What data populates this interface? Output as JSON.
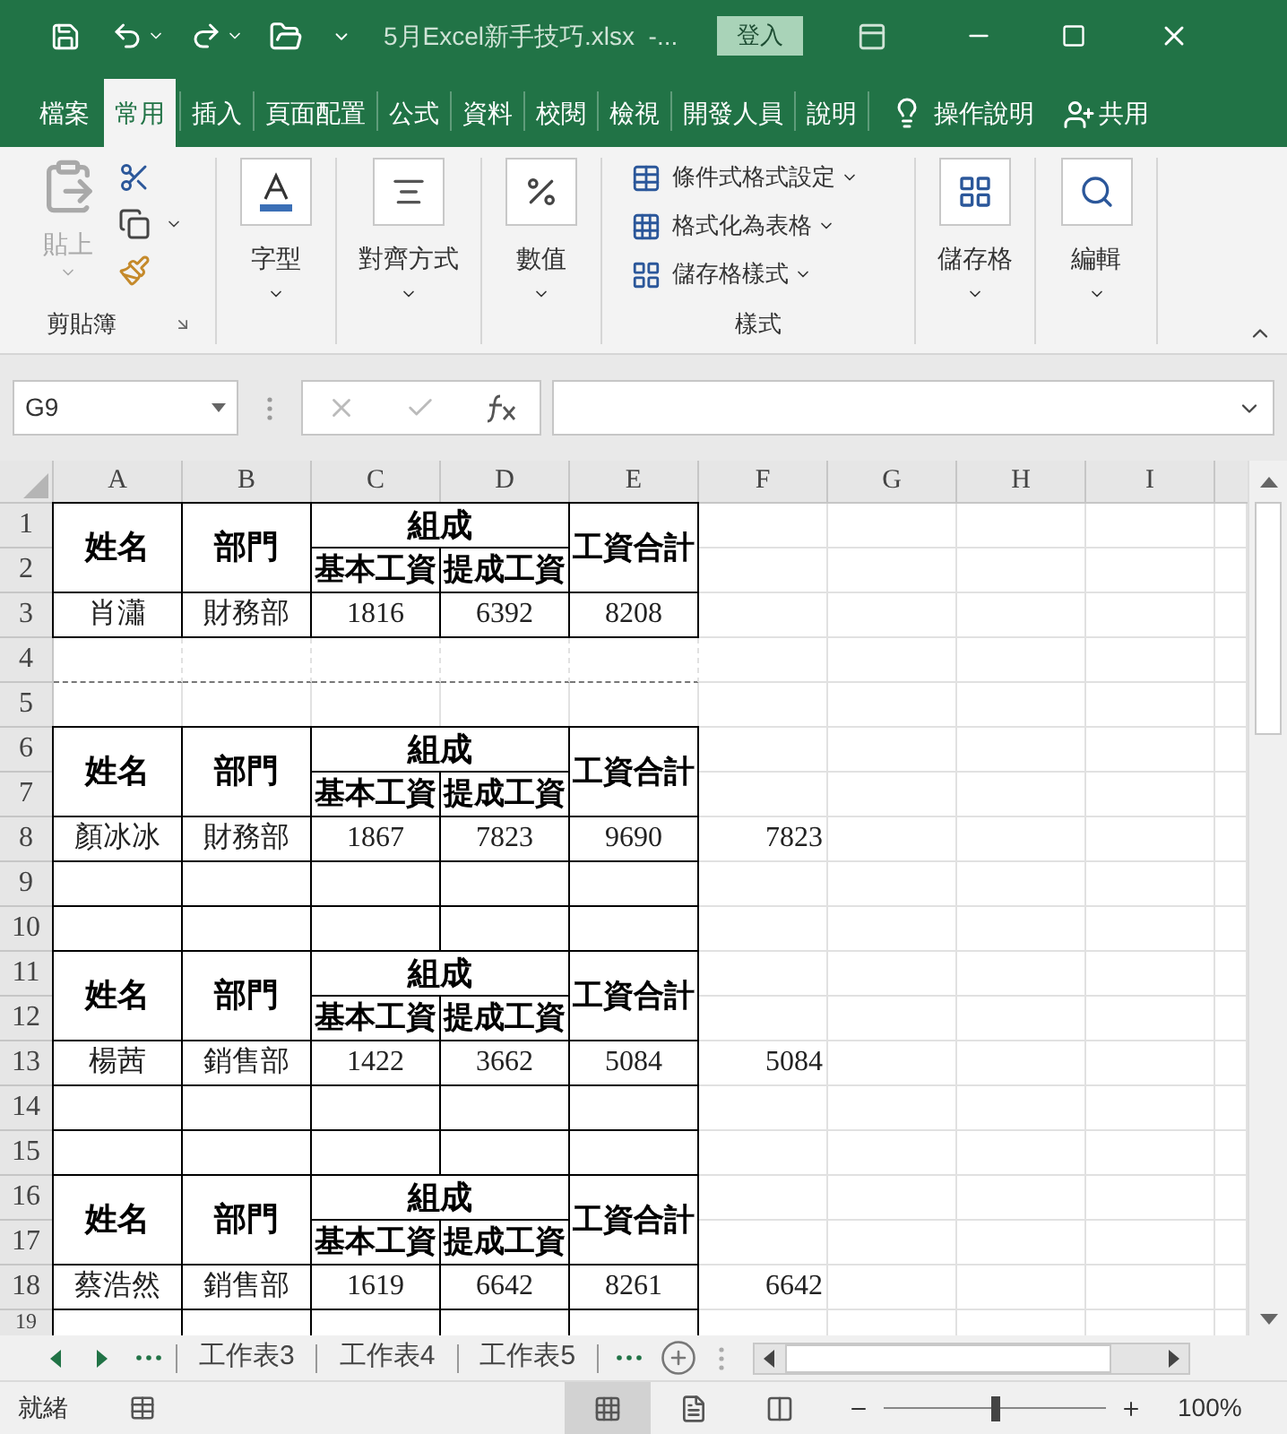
{
  "title_bar": {
    "document_title": "5月Excel新手技巧.xlsx  -...",
    "sign_in": "登入"
  },
  "ribbon_tabs": [
    {
      "label": "檔案",
      "selected": false
    },
    {
      "label": "常用",
      "selected": true
    },
    {
      "label": "插入",
      "selected": false
    },
    {
      "label": "頁面配置",
      "selected": false
    },
    {
      "label": "公式",
      "selected": false
    },
    {
      "label": "資料",
      "selected": false
    },
    {
      "label": "校閱",
      "selected": false
    },
    {
      "label": "檢視",
      "selected": false
    },
    {
      "label": "開發人員",
      "selected": false
    },
    {
      "label": "說明",
      "selected": false
    }
  ],
  "tell_me": "操作說明",
  "share": "共用",
  "ribbon_groups": [
    {
      "kind": "clipboard",
      "button": "貼上",
      "label": "剪貼簿"
    },
    {
      "kind": "font",
      "button": "字型"
    },
    {
      "kind": "alignment",
      "button": "對齊方式"
    },
    {
      "kind": "number",
      "button": "數值"
    },
    {
      "kind": "styles",
      "items": [
        "條件式格式設定",
        "格式化為表格",
        "儲存格樣式"
      ],
      "label": "樣式"
    },
    {
      "kind": "cells",
      "button": "儲存格"
    },
    {
      "kind": "editing",
      "button": "編輯"
    }
  ],
  "name_box": "G9",
  "column_headers": [
    "A",
    "B",
    "C",
    "D",
    "E",
    "F",
    "G",
    "H",
    "I"
  ],
  "row_headers": [
    "1",
    "2",
    "3",
    "4",
    "5",
    "6",
    "7",
    "8",
    "9",
    "10",
    "11",
    "12",
    "13",
    "14",
    "15",
    "16",
    "17",
    "18",
    "19"
  ],
  "tables": [
    {
      "header": {
        "name": "姓名",
        "dept": "部門",
        "group": "組成",
        "sub": [
          "基本工資",
          "提成工資"
        ],
        "total": "工資合計"
      },
      "record": [
        "肖瀟",
        "財務部",
        "1816",
        "6392",
        "8208"
      ],
      "rows_below_bordered": false,
      "page_break": true
    },
    {
      "header": {
        "name": "姓名",
        "dept": "部門",
        "group": "組成",
        "sub": [
          "基本工資",
          "提成工資"
        ],
        "total": "工資合計"
      },
      "record": [
        "顏冰冰",
        "財務部",
        "1867",
        "7823",
        "9690"
      ],
      "f_value": "7823",
      "rows_below_bordered": true,
      "page_break": false
    },
    {
      "header": {
        "name": "姓名",
        "dept": "部門",
        "group": "組成",
        "sub": [
          "基本工資",
          "提成工資"
        ],
        "total": "工資合計"
      },
      "record": [
        "楊茜",
        "銷售部",
        "1422",
        "3662",
        "5084"
      ],
      "f_value": "5084",
      "rows_below_bordered": true,
      "page_break": false
    },
    {
      "header": {
        "name": "姓名",
        "dept": "部門",
        "group": "組成",
        "sub": [
          "基本工資",
          "提成工資"
        ],
        "total": "工資合計"
      },
      "record": [
        "蔡浩然",
        "銷售部",
        "1619",
        "6642",
        "8261"
      ],
      "f_value": "6642",
      "rows_below_bordered": true,
      "page_break": false
    }
  ],
  "sheet_tabs": [
    "工作表3",
    "工作表4",
    "工作表5"
  ],
  "status": "就緒",
  "views": [
    {
      "kind": "normal",
      "selected": true
    },
    {
      "kind": "page-layout",
      "selected": false
    },
    {
      "kind": "page-break",
      "selected": false
    }
  ],
  "zoom_slider": {
    "level": 0.5
  },
  "zoom": "100%"
}
